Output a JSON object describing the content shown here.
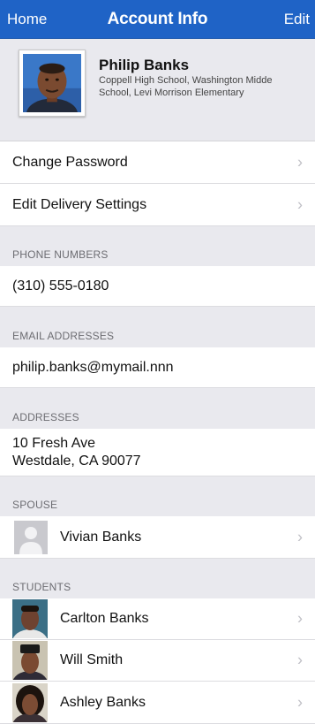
{
  "navbar": {
    "left": "Home",
    "title": "Account Info",
    "right": "Edit"
  },
  "profile": {
    "name": "Philip Banks",
    "schools": "Coppell High School, Washington Midde School, Levi Morrison Elementary"
  },
  "actions": {
    "change_password": "Change Password",
    "delivery_settings": "Edit Delivery Settings"
  },
  "phone": {
    "header": "PHONE NUMBERS",
    "value": "(310) 555-0180"
  },
  "email": {
    "header": "EMAIL ADDRESSES",
    "value": "philip.banks@mymail.nnn"
  },
  "address": {
    "header": "ADDRESSES",
    "line1": "10 Fresh Ave",
    "line2": "Westdale, CA 90077"
  },
  "spouse": {
    "header": "SPOUSE",
    "name": "Vivian Banks"
  },
  "students": {
    "header": "STUDENTS",
    "items": [
      {
        "name": "Carlton Banks"
      },
      {
        "name": "Will Smith"
      },
      {
        "name": "Ashley Banks"
      }
    ]
  },
  "icons": {
    "chevron": "›"
  },
  "colors": {
    "navbar": "#1f63c6",
    "background": "#e9e9ee",
    "chevron": "#c0c0c6"
  }
}
